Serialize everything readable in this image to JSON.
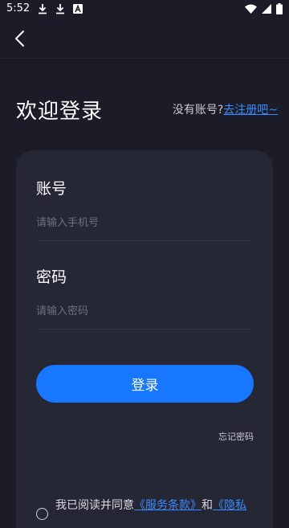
{
  "status_bar": {
    "time": "5:52",
    "icons": [
      "download-icon",
      "download-icon",
      "a-notification-icon",
      "wifi-icon",
      "signal-icon",
      "battery-icon"
    ]
  },
  "header": {
    "title": "欢迎登录",
    "register_prompt": "没有账号?",
    "register_link": "去注册吧~"
  },
  "form": {
    "account_label": "账号",
    "account_placeholder": "请输入手机号",
    "password_label": "密码",
    "password_placeholder": "请输入密码",
    "login_button": "登录",
    "forgot_password": "忘记密码"
  },
  "agreement": {
    "prefix": "我已阅读并同意",
    "terms_link": "《服务条款》",
    "conjunction": "和",
    "privacy_link": "《隐私"
  },
  "colors": {
    "background": "#1b1c28",
    "card": "#262735",
    "accent": "#1777ff",
    "link": "#3a8bff"
  }
}
